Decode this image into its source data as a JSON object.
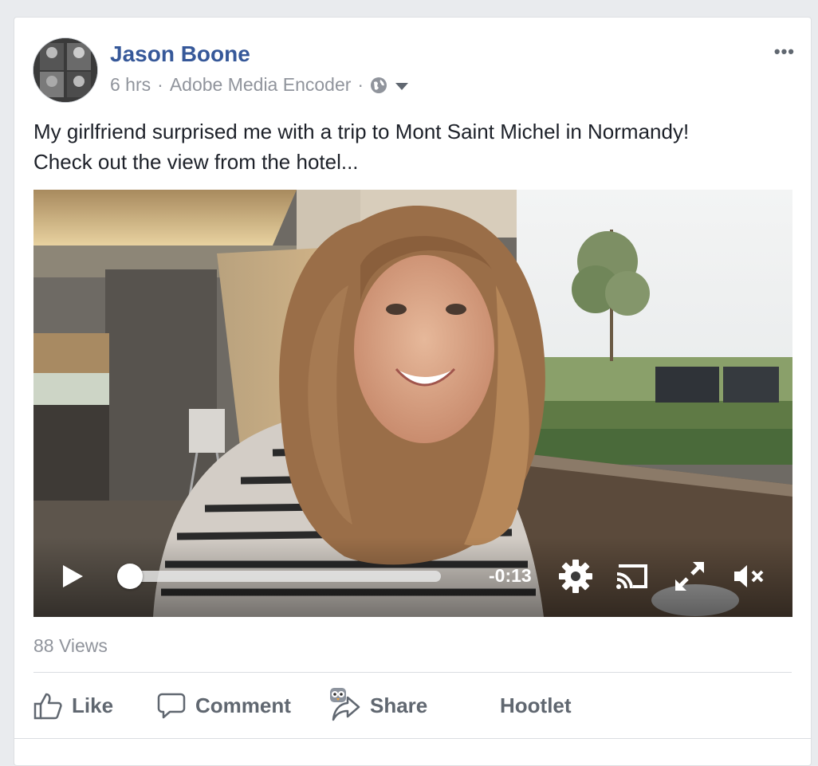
{
  "post": {
    "author": "Jason Boone",
    "age": "6 hrs",
    "sep1": "·",
    "source": "Adobe Media Encoder",
    "sep2": "·",
    "more": "•••",
    "text_line1": "My girlfriend surprised me with a trip to Mont Saint Michel in Normandy!",
    "text_line2": "Check out the view from the hotel..."
  },
  "video": {
    "remaining_time": "-0:13",
    "progress": 0
  },
  "stats": {
    "views": "88 Views"
  },
  "actions": {
    "like": "Like",
    "comment": "Comment",
    "share": "Share",
    "hootlet": "Hootlet"
  },
  "colors": {
    "author": "#365899",
    "meta": "#90949c",
    "action": "#606770",
    "background": "#e9ebee"
  },
  "icons": [
    "globe-icon",
    "chevron-down-icon",
    "more-icon",
    "play-icon",
    "gear-icon",
    "cast-icon",
    "fullscreen-icon",
    "mute-icon",
    "like-icon",
    "comment-icon",
    "share-icon",
    "owl-icon"
  ]
}
